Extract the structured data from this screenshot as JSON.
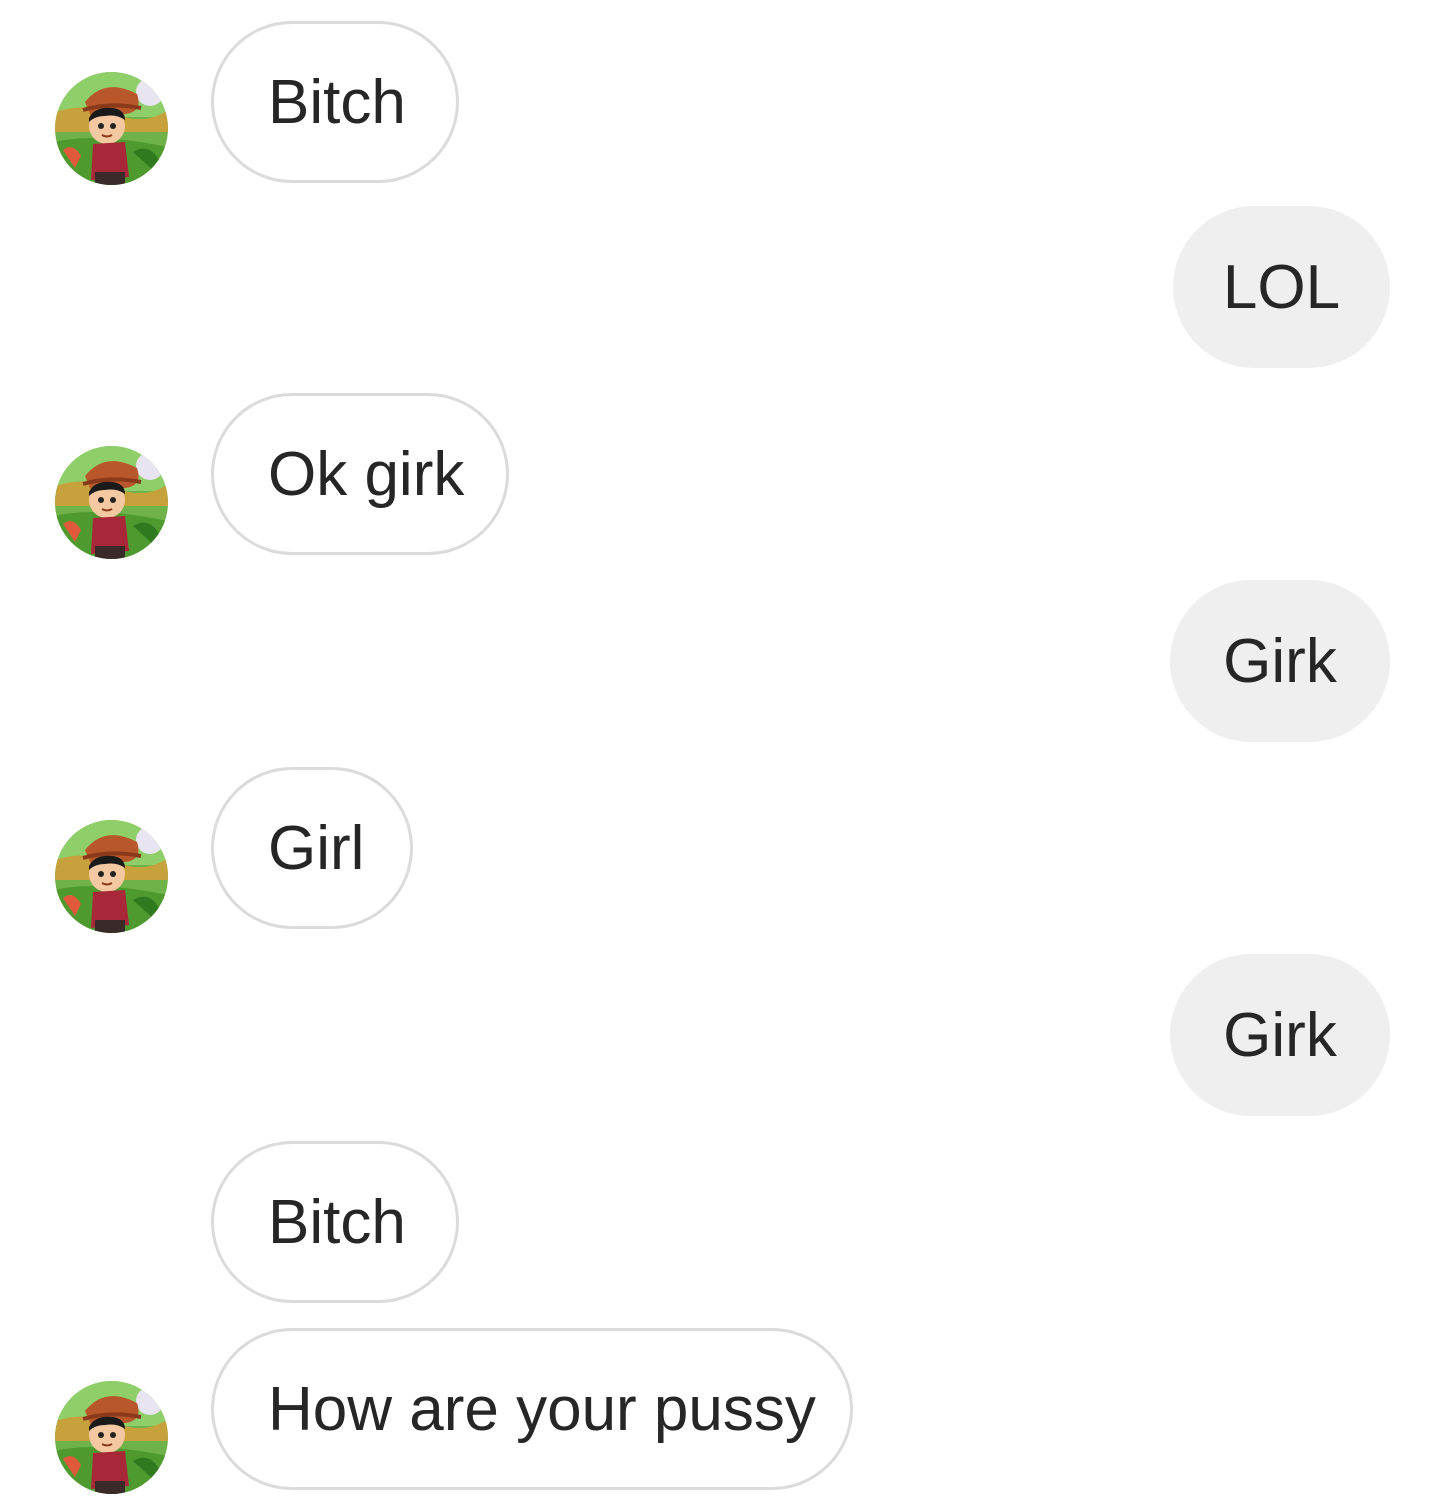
{
  "conversation": {
    "messages": [
      {
        "sender": "them",
        "text": "Bitch"
      },
      {
        "sender": "me",
        "text": "LOL"
      },
      {
        "sender": "them",
        "text": "Ok girk"
      },
      {
        "sender": "me",
        "text": "Girk"
      },
      {
        "sender": "them",
        "text": "Girl"
      },
      {
        "sender": "me",
        "text": "Girk"
      },
      {
        "sender": "them",
        "text": "Bitch"
      },
      {
        "sender": "them",
        "text": "How are your pussy"
      }
    ],
    "avatar_icon": "cartoon-character-avatar-icon"
  },
  "colors": {
    "incoming_border": "#dbdbdb",
    "outgoing_bg": "#efefef",
    "text": "#262626",
    "background": "#ffffff"
  }
}
